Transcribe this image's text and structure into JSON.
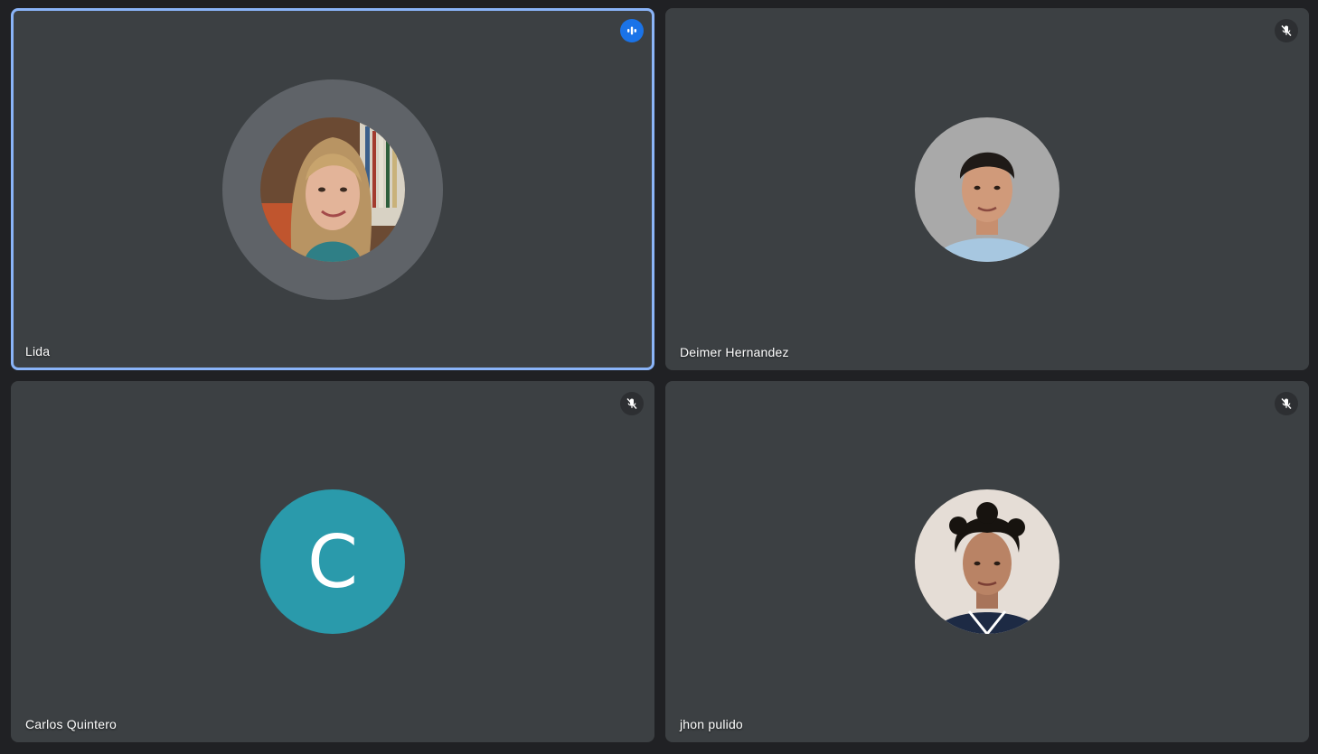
{
  "participants": [
    {
      "name": "Lida",
      "status": "speaking",
      "avatar": "photo-woman-long-hair"
    },
    {
      "name": "Deimer Hernandez",
      "status": "muted",
      "avatar": "photo-man-short-dark-hair"
    },
    {
      "name": "Carlos Quintero",
      "status": "muted",
      "avatar": "letter",
      "initial": "C",
      "avatar_color": "#2a9aab"
    },
    {
      "name": "jhon pulido",
      "status": "muted",
      "avatar": "photo-man-curly-hair"
    }
  ],
  "colors": {
    "background": "#202124",
    "tile": "#3c4043",
    "speaking_border": "#8ab4f8",
    "speaking_badge": "#1a73e8"
  },
  "icons": {
    "speaking": "audio-level-icon",
    "muted": "mic-off-icon"
  }
}
